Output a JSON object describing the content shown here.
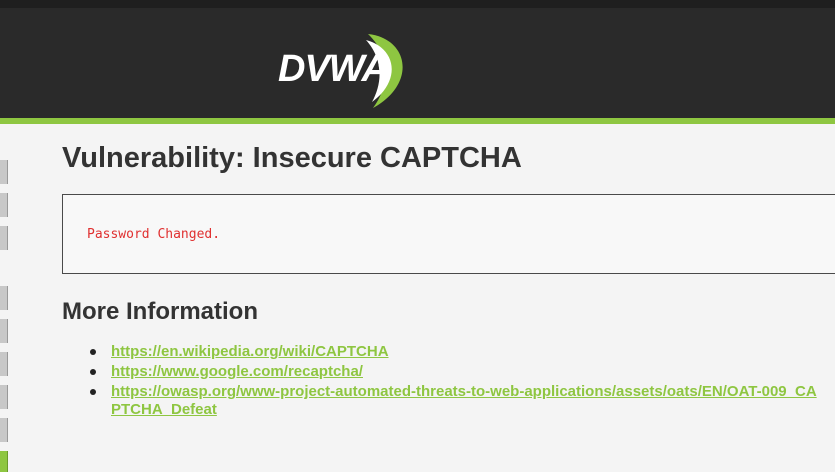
{
  "header": {
    "logo_text": "DVWA"
  },
  "page": {
    "title": "Vulnerability: Insecure CAPTCHA",
    "message": "Password Changed.",
    "more_info_title": "More Information",
    "links": [
      "https://en.wikipedia.org/wiki/CAPTCHA",
      "https://www.google.com/recaptcha/",
      "https://owasp.org/www-project-automated-threats-to-web-applications/assets/oats/EN/OAT-009_CAPTCHA_Defeat"
    ]
  },
  "colors": {
    "header_bg": "#2a2a2a",
    "accent_green": "#8ec641",
    "message_red": "#e03030",
    "page_bg": "#f4f4f4"
  }
}
